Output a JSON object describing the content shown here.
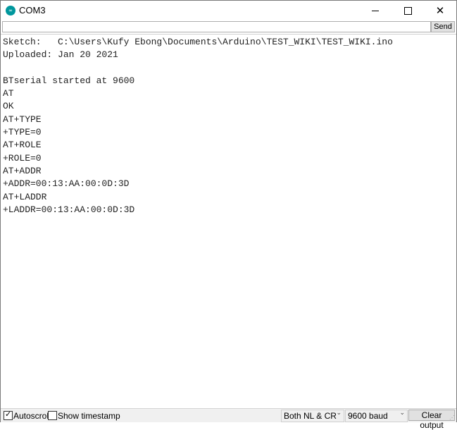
{
  "window": {
    "title": "COM3",
    "icon": "arduino-icon"
  },
  "input": {
    "value": "",
    "send_label": "Send"
  },
  "output_lines": [
    "Sketch:   C:\\Users\\Kufy Ebong\\Documents\\Arduino\\TEST_WIKI\\TEST_WIKI.ino",
    "Uploaded: Jan 20 2021",
    "",
    "BTserial started at 9600",
    "AT",
    "OK",
    "AT+TYPE",
    "+TYPE=0",
    "AT+ROLE",
    "+ROLE=0",
    "AT+ADDR",
    "+ADDR=00:13:AA:00:0D:3D",
    "AT+LADDR",
    "+LADDR=00:13:AA:00:0D:3D"
  ],
  "status": {
    "autoscroll_label": "Autoscroll",
    "autoscroll_checked": true,
    "timestamp_label": "Show timestamp",
    "timestamp_checked": false,
    "line_ending": "Both NL & CR",
    "baud": "9600 baud",
    "clear_label": "Clear output"
  }
}
